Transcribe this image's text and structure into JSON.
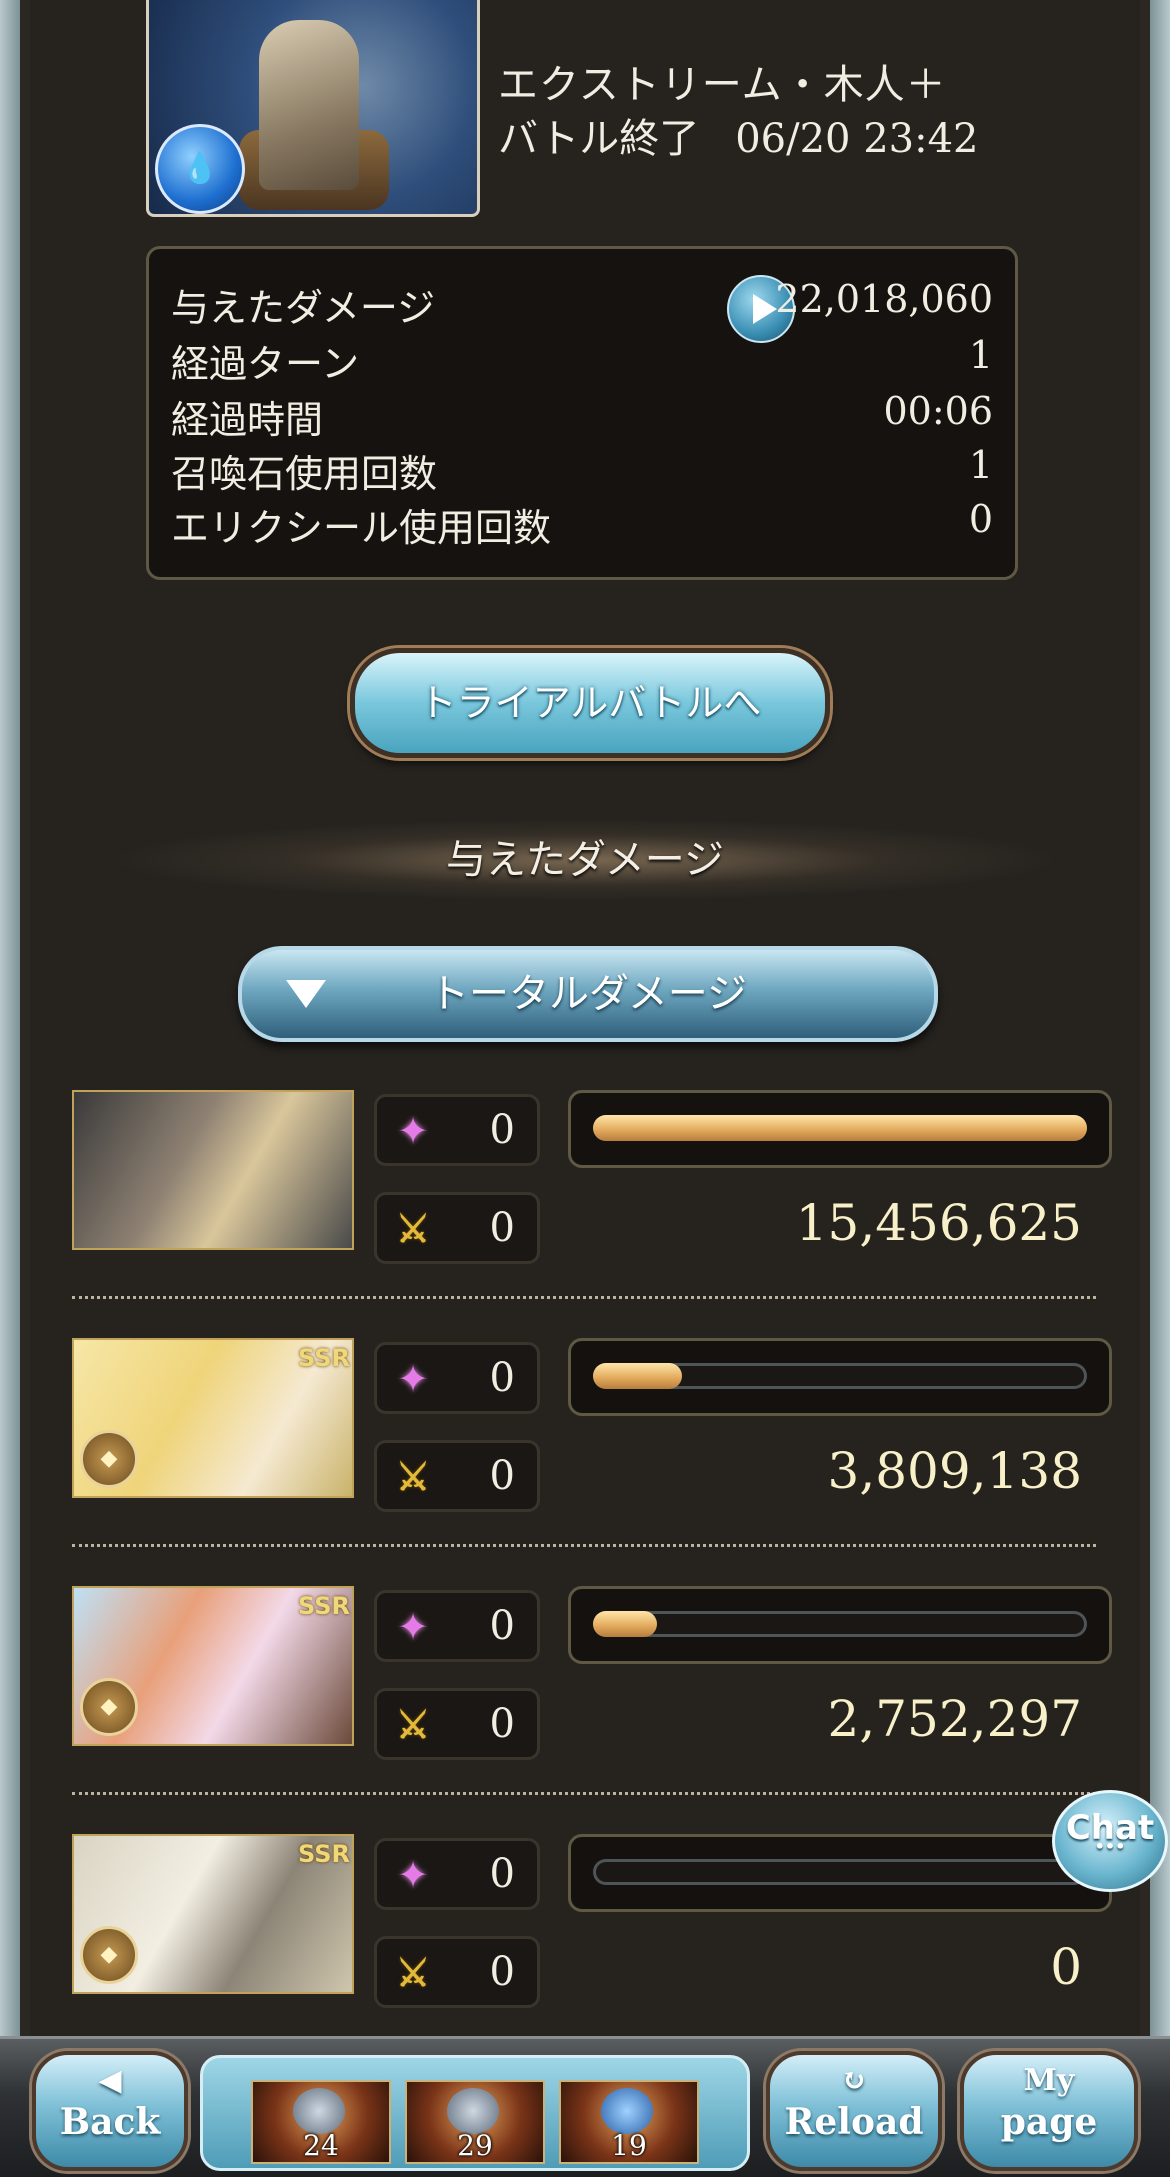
{
  "header": {
    "quest_name": "エクストリーム・木人＋",
    "battle_end_label": "バトル終了",
    "battle_end_datetime": "06/20 23:42",
    "element_badge": "water-element-icon"
  },
  "stats": [
    {
      "label": "与えたダメージ",
      "value": "22,018,060"
    },
    {
      "label": "経過ターン",
      "value": "1"
    },
    {
      "label": "経過時間",
      "value": "00:06"
    },
    {
      "label": "召喚石使用回数",
      "value": "1"
    },
    {
      "label": "エリクシール使用回数",
      "value": "0"
    }
  ],
  "trial_button": "トライアルバトルへ",
  "section_title": "与えたダメージ",
  "dropdown": {
    "selected": "トータルダメージ"
  },
  "characters": [
    {
      "portrait_icon": "character-portrait-1",
      "ssr": "",
      "special_count": "0",
      "skill_count": "0",
      "damage": "15,456,625",
      "bar_fraction": 1.0
    },
    {
      "portrait_icon": "character-portrait-2",
      "ssr": "SSR",
      "special_count": "0",
      "skill_count": "0",
      "damage": "3,809,138",
      "bar_fraction": 0.18
    },
    {
      "portrait_icon": "character-portrait-3",
      "ssr": "SSR",
      "special_count": "0",
      "skill_count": "0",
      "damage": "2,752,297",
      "bar_fraction": 0.13
    },
    {
      "portrait_icon": "character-portrait-4",
      "ssr": "SSR",
      "special_count": "0",
      "skill_count": "0",
      "damage": "0",
      "bar_fraction": 0.0
    }
  ],
  "chat_button": {
    "label": "Chat",
    "sub": "•••"
  },
  "footer": {
    "back": {
      "top": "◀",
      "label": "Back"
    },
    "items": [
      "24",
      "29",
      "19"
    ],
    "reload": {
      "top": "↻",
      "label": "Reload"
    },
    "mypage": {
      "top": "My",
      "label": "page"
    }
  },
  "colors": {
    "bar_fill": "#e1a85b",
    "damage_text": "#f7f0c9",
    "panel_bg": "#26231f"
  }
}
